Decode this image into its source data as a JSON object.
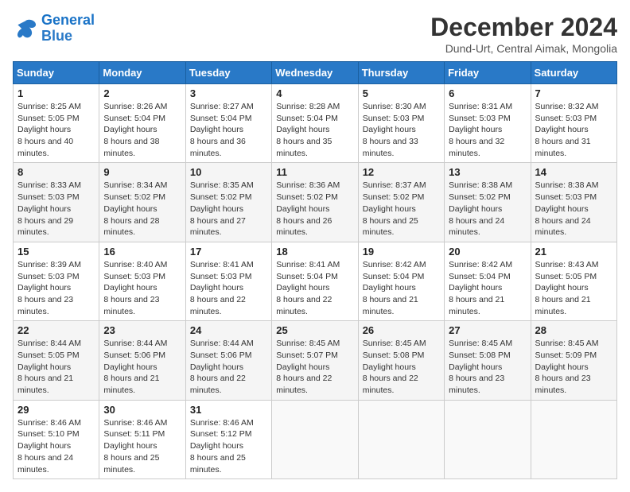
{
  "logo": {
    "line1": "General",
    "line2": "Blue"
  },
  "title": "December 2024",
  "subtitle": "Dund-Urt, Central Aimak, Mongolia",
  "header_days": [
    "Sunday",
    "Monday",
    "Tuesday",
    "Wednesday",
    "Thursday",
    "Friday",
    "Saturday"
  ],
  "weeks": [
    [
      {
        "day": "1",
        "sunrise": "8:25 AM",
        "sunset": "5:05 PM",
        "daylight": "8 hours and 40 minutes."
      },
      {
        "day": "2",
        "sunrise": "8:26 AM",
        "sunset": "5:04 PM",
        "daylight": "8 hours and 38 minutes."
      },
      {
        "day": "3",
        "sunrise": "8:27 AM",
        "sunset": "5:04 PM",
        "daylight": "8 hours and 36 minutes."
      },
      {
        "day": "4",
        "sunrise": "8:28 AM",
        "sunset": "5:04 PM",
        "daylight": "8 hours and 35 minutes."
      },
      {
        "day": "5",
        "sunrise": "8:30 AM",
        "sunset": "5:03 PM",
        "daylight": "8 hours and 33 minutes."
      },
      {
        "day": "6",
        "sunrise": "8:31 AM",
        "sunset": "5:03 PM",
        "daylight": "8 hours and 32 minutes."
      },
      {
        "day": "7",
        "sunrise": "8:32 AM",
        "sunset": "5:03 PM",
        "daylight": "8 hours and 31 minutes."
      }
    ],
    [
      {
        "day": "8",
        "sunrise": "8:33 AM",
        "sunset": "5:03 PM",
        "daylight": "8 hours and 29 minutes."
      },
      {
        "day": "9",
        "sunrise": "8:34 AM",
        "sunset": "5:02 PM",
        "daylight": "8 hours and 28 minutes."
      },
      {
        "day": "10",
        "sunrise": "8:35 AM",
        "sunset": "5:02 PM",
        "daylight": "8 hours and 27 minutes."
      },
      {
        "day": "11",
        "sunrise": "8:36 AM",
        "sunset": "5:02 PM",
        "daylight": "8 hours and 26 minutes."
      },
      {
        "day": "12",
        "sunrise": "8:37 AM",
        "sunset": "5:02 PM",
        "daylight": "8 hours and 25 minutes."
      },
      {
        "day": "13",
        "sunrise": "8:38 AM",
        "sunset": "5:02 PM",
        "daylight": "8 hours and 24 minutes."
      },
      {
        "day": "14",
        "sunrise": "8:38 AM",
        "sunset": "5:03 PM",
        "daylight": "8 hours and 24 minutes."
      }
    ],
    [
      {
        "day": "15",
        "sunrise": "8:39 AM",
        "sunset": "5:03 PM",
        "daylight": "8 hours and 23 minutes."
      },
      {
        "day": "16",
        "sunrise": "8:40 AM",
        "sunset": "5:03 PM",
        "daylight": "8 hours and 23 minutes."
      },
      {
        "day": "17",
        "sunrise": "8:41 AM",
        "sunset": "5:03 PM",
        "daylight": "8 hours and 22 minutes."
      },
      {
        "day": "18",
        "sunrise": "8:41 AM",
        "sunset": "5:04 PM",
        "daylight": "8 hours and 22 minutes."
      },
      {
        "day": "19",
        "sunrise": "8:42 AM",
        "sunset": "5:04 PM",
        "daylight": "8 hours and 21 minutes."
      },
      {
        "day": "20",
        "sunrise": "8:42 AM",
        "sunset": "5:04 PM",
        "daylight": "8 hours and 21 minutes."
      },
      {
        "day": "21",
        "sunrise": "8:43 AM",
        "sunset": "5:05 PM",
        "daylight": "8 hours and 21 minutes."
      }
    ],
    [
      {
        "day": "22",
        "sunrise": "8:44 AM",
        "sunset": "5:05 PM",
        "daylight": "8 hours and 21 minutes."
      },
      {
        "day": "23",
        "sunrise": "8:44 AM",
        "sunset": "5:06 PM",
        "daylight": "8 hours and 21 minutes."
      },
      {
        "day": "24",
        "sunrise": "8:44 AM",
        "sunset": "5:06 PM",
        "daylight": "8 hours and 22 minutes."
      },
      {
        "day": "25",
        "sunrise": "8:45 AM",
        "sunset": "5:07 PM",
        "daylight": "8 hours and 22 minutes."
      },
      {
        "day": "26",
        "sunrise": "8:45 AM",
        "sunset": "5:08 PM",
        "daylight": "8 hours and 22 minutes."
      },
      {
        "day": "27",
        "sunrise": "8:45 AM",
        "sunset": "5:08 PM",
        "daylight": "8 hours and 23 minutes."
      },
      {
        "day": "28",
        "sunrise": "8:45 AM",
        "sunset": "5:09 PM",
        "daylight": "8 hours and 23 minutes."
      }
    ],
    [
      {
        "day": "29",
        "sunrise": "8:46 AM",
        "sunset": "5:10 PM",
        "daylight": "8 hours and 24 minutes."
      },
      {
        "day": "30",
        "sunrise": "8:46 AM",
        "sunset": "5:11 PM",
        "daylight": "8 hours and 25 minutes."
      },
      {
        "day": "31",
        "sunrise": "8:46 AM",
        "sunset": "5:12 PM",
        "daylight": "8 hours and 25 minutes."
      },
      null,
      null,
      null,
      null
    ]
  ]
}
